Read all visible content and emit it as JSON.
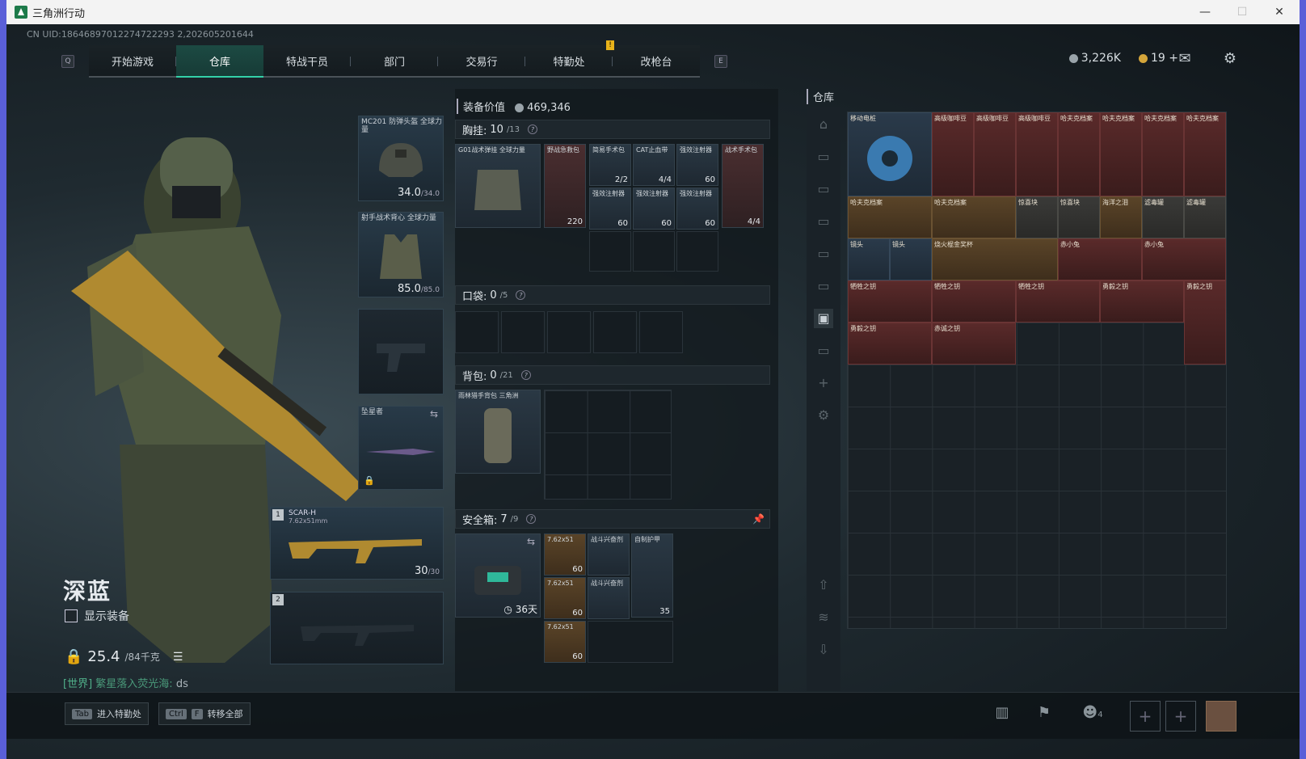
{
  "window": {
    "title": "三角洲行动"
  },
  "uid": "CN UID:18646897012274722293 2,202605201644",
  "nav": {
    "left_key": "Q",
    "right_key": "E",
    "tabs": [
      {
        "label": "开始游戏"
      },
      {
        "label": "仓库"
      },
      {
        "label": "特战干员"
      },
      {
        "label": "部门"
      },
      {
        "label": "交易行"
      },
      {
        "label": "特勤处"
      },
      {
        "label": "改枪台"
      }
    ],
    "active_tab": "仓库",
    "notif": "!"
  },
  "currency": {
    "silver": "3,226K",
    "gold": "19",
    "plus": "+"
  },
  "player": {
    "name": "深蓝",
    "show_gear_label": "显示装备",
    "weight": "25.4",
    "weight_max": "/84千克",
    "chat_channel": "[世界]",
    "chat_user": "繁星落入荧光海:",
    "chat_msg": "ds"
  },
  "equipment": {
    "helmet": {
      "name": "MC201 防弹头盔 全球力量",
      "value": "34.0",
      "max": "/34.0"
    },
    "armor": {
      "name": "射手战术背心 全球力量",
      "value": "85.0",
      "max": "/85.0"
    },
    "melee": {
      "name": "坠星者"
    },
    "primary": {
      "slot": "1",
      "name": "SCAR-H",
      "caliber": "7.62x51mm",
      "ammo": "30",
      "ammo_max": "/30"
    },
    "secondary": {
      "slot": "2"
    }
  },
  "loadout": {
    "value_label": "装备价值",
    "value": "469,346",
    "chest": {
      "label": "胸挂:",
      "count": "10",
      "max": "/13",
      "rig_name": "G01战术弹挂 全球力量"
    },
    "chest_items": [
      {
        "name": "野战急救包",
        "count": "220"
      },
      {
        "name": "简易手术包",
        "count": "2/2"
      },
      {
        "name": "CAT止血带",
        "count": "4/4"
      },
      {
        "name": "强效注射器",
        "count": "60"
      },
      {
        "name": "战术手术包",
        "count": "4/4"
      },
      {
        "name": "强效注射器",
        "count": "60"
      },
      {
        "name": "强效注射器",
        "count": "60"
      },
      {
        "name": "强效注射器",
        "count": "60"
      }
    ],
    "pocket": {
      "label": "口袋:",
      "count": "0",
      "max": "/5"
    },
    "backpack": {
      "label": "背包:",
      "count": "0",
      "max": "/21",
      "name": "雨林猎手背包 三角洲"
    },
    "safe": {
      "label": "安全箱:",
      "count": "7",
      "max": "/9",
      "days": "36天"
    },
    "safe_items": [
      {
        "name": "7.62x51",
        "count": "60"
      },
      {
        "name": "战斗兴奋剂",
        "count": ""
      },
      {
        "name": "自制护甲",
        "count": "35"
      },
      {
        "name": "7.62x51",
        "count": "60"
      },
      {
        "name": "战斗兴奋剂",
        "count": ""
      },
      {
        "name": "7.62x51",
        "count": "60"
      }
    ]
  },
  "warehouse": {
    "title": "仓库",
    "items": [
      {
        "name": "移动电桩"
      },
      {
        "name": "高级咖啡豆"
      },
      {
        "name": "高级咖啡豆"
      },
      {
        "name": "高级咖啡豆"
      },
      {
        "name": "哈夫克档案"
      },
      {
        "name": "哈夫克档案"
      },
      {
        "name": "哈夫克档案"
      },
      {
        "name": "哈夫克档案"
      },
      {
        "name": "哈夫克档案"
      },
      {
        "name": "哈夫克档案"
      },
      {
        "name": "惊喜块"
      },
      {
        "name": "惊喜块"
      },
      {
        "name": "海洋之泪"
      },
      {
        "name": "滤毒罐"
      },
      {
        "name": "滤毒罐"
      },
      {
        "name": "镜头"
      },
      {
        "name": "镜头"
      },
      {
        "name": "烧火棍金奖杯"
      },
      {
        "name": "赤小兔"
      },
      {
        "name": "赤小兔"
      },
      {
        "name": "牺牲之钥"
      },
      {
        "name": "牺牲之钥"
      },
      {
        "name": "牺牲之钥"
      },
      {
        "name": "勇毅之钥"
      },
      {
        "name": "勇毅之钥"
      },
      {
        "name": "勇毅之钥"
      },
      {
        "name": "赤诚之钥"
      }
    ]
  },
  "bottom": {
    "hint1_key": "Tab",
    "hint1_label": "进入特勤处",
    "hint2_key1": "Ctrl",
    "hint2_key2": "F",
    "hint2_label": "转移全部",
    "friends_count": "4"
  }
}
